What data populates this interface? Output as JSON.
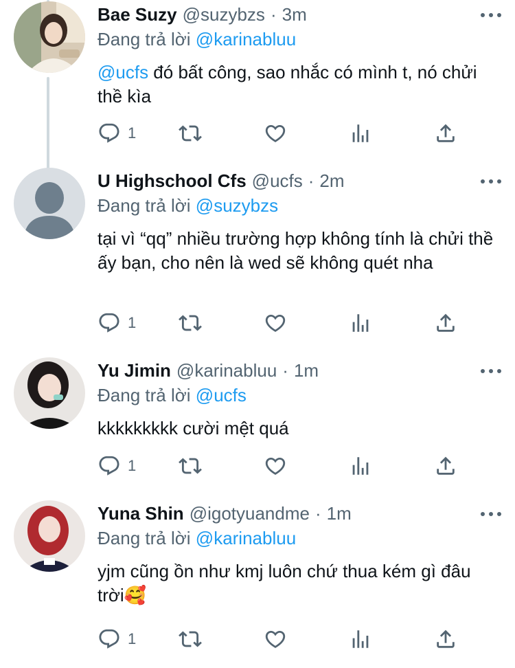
{
  "tweets": [
    {
      "name": "Bae Suzy",
      "handle": "@suzybzs",
      "dot": "·",
      "time": "3m",
      "replying_prefix": "Đang trả lời",
      "replying_to": "@karinabluu",
      "text_mention": "@ucfs",
      "text": " đó bất công, sao nhắc có mình t, nó chửi thề kìa",
      "reply_count": "1",
      "avatar": "photo-woman-beige"
    },
    {
      "name": "U Highschool Cfs",
      "handle": "@ucfs",
      "dot": "·",
      "time": "2m",
      "replying_prefix": "Đang trả lời",
      "replying_to": "@suzybzs",
      "text_mention": "",
      "text": "tại vì “qq” nhiều trường hợp không tính là chửi thề ấy bạn, cho nên là wed sẽ không quét nha",
      "reply_count": "1",
      "avatar": "default-person"
    },
    {
      "name": "Yu Jimin",
      "handle": "@karinabluu",
      "dot": "·",
      "time": "1m",
      "replying_prefix": "Đang trả lời",
      "replying_to": "@ucfs",
      "text_mention": "",
      "text": "kkkkkkkkk cười mệt quá",
      "reply_count": "1",
      "avatar": "photo-woman-black-top"
    },
    {
      "name": "Yuna Shin",
      "handle": "@igotyuandme",
      "dot": "·",
      "time": "1m",
      "replying_prefix": "Đang trả lời",
      "replying_to": "@karinabluu",
      "text_mention": "",
      "text": "yjm cũng ồn như kmj luôn chứ thua kém gì đâu trời🥰",
      "reply_count": "1",
      "avatar": "photo-woman-red-hair"
    }
  ],
  "icons": [
    "reply-icon",
    "retweet-icon",
    "like-icon",
    "views-icon",
    "share-icon",
    "more-icon"
  ],
  "colors": {
    "link": "#1d9bf0",
    "secondary": "#536471",
    "thread_line": "#cfd9de",
    "default_avatar_bg": "#d9dee3",
    "default_avatar_fg": "#6e7f8d"
  }
}
